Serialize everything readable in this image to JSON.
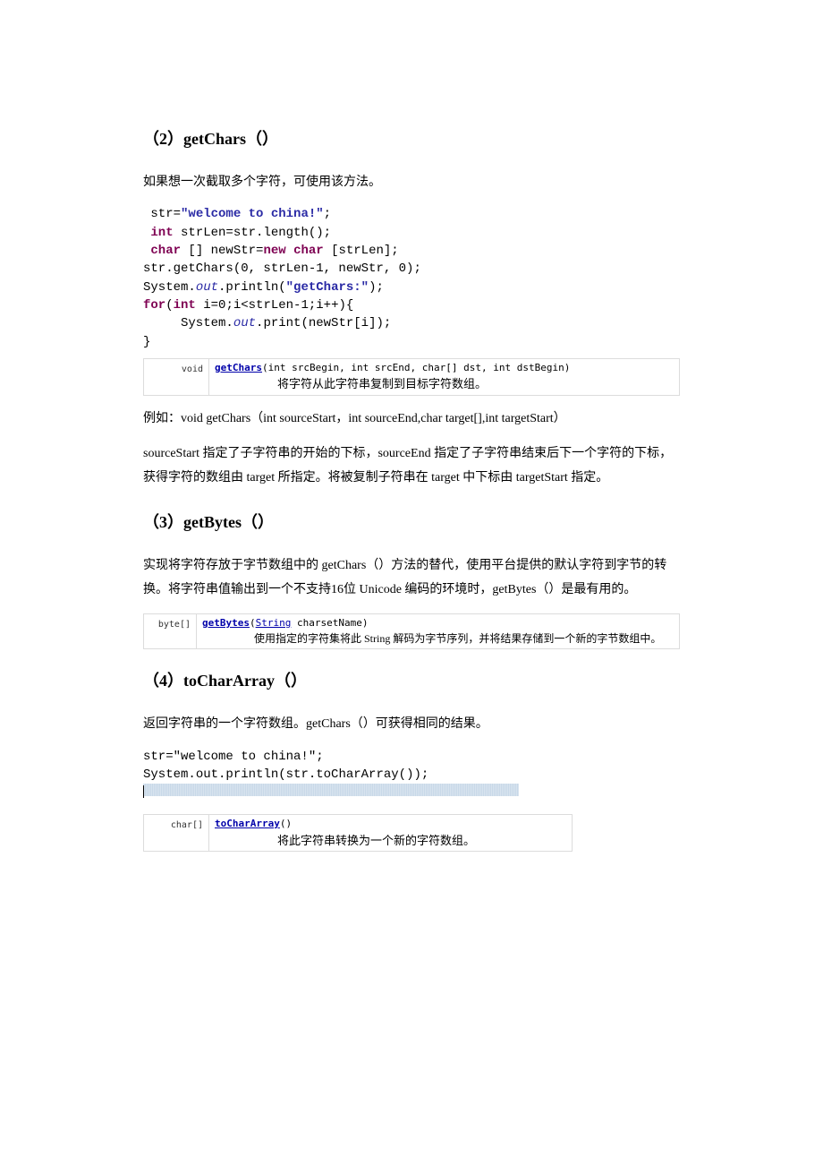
{
  "h_getChars": "（2）getChars（）",
  "p_getChars_intro": "如果想一次截取多个字符，可使用该方法。",
  "code_getChars_l1a": " str=",
  "code_getChars_l1b": "\"welcome to china!\"",
  "code_getChars_l1c": ";",
  "code_getChars_l2a": " ",
  "code_getChars_kw_int": "int",
  "code_getChars_l2b": " strLen=str.length();",
  "code_getChars_l3a": " ",
  "code_getChars_kw_char": "char",
  "code_getChars_l3b": " [] newStr=",
  "code_getChars_kw_new": "new",
  "code_getChars_l3c": " ",
  "code_getChars_kw_char2": "char",
  "code_getChars_l3d": " [strLen];",
  "code_getChars_l4": "str.getChars(0, strLen-1, newStr, 0);",
  "code_getChars_l5a": "System.",
  "code_getChars_stat_out": "out",
  "code_getChars_l5b": ".println(",
  "code_getChars_l5c": "\"getChars:\"",
  "code_getChars_l5d": ");",
  "code_getChars_l6a": "",
  "code_getChars_kw_for": "for",
  "code_getChars_l6b": "(",
  "code_getChars_kw_int2": "int",
  "code_getChars_l6c": " i=0;i<strLen-1;i++){",
  "code_getChars_l7a": "     System.",
  "code_getChars_l7b": ".print(newStr[i]);",
  "code_getChars_l8": "}",
  "doc_getChars_ret": "void",
  "doc_getChars_name": "getChars",
  "doc_getChars_params": "(int srcBegin, int srcEnd, char[] dst, int dstBegin)",
  "doc_getChars_desc": "将字符从此字符串复制到目标字符数组。",
  "p_example": "例如：void getChars（int sourceStart，int sourceEnd,char target[],int targetStart）",
  "p_source_desc": "sourceStart 指定了子字符串的开始的下标，sourceEnd 指定了子字符串结束后下一个字符的下标，获得字符的数组由 target 所指定。将被复制子符串在 target 中下标由 targetStart 指定。",
  "h_getBytes": "（3）getBytes（）",
  "p_getBytes_intro": "实现将字符存放于字节数组中的 getChars（）方法的替代，使用平台提供的默认字符到字节的转换。将字符串值输出到一个不支持16位 Unicode 编码的环境时，getBytes（）是最有用的。",
  "doc_getBytes_ret": "byte[]",
  "doc_getBytes_name": "getBytes",
  "doc_getBytes_ptype": "String",
  "doc_getBytes_pname": " charsetName)",
  "doc_getBytes_desc": "使用指定的字符集将此 String 解码为字节序列，并将结果存储到一个新的字节数组中。",
  "h_toCharArray": "（4）toCharArray（）",
  "p_toCharArray_intro": "返回字符串的一个字符数组。getChars（）可获得相同的结果。",
  "code_tca_l1a": "str=",
  "code_tca_l1b": "\"welcome to china!\"",
  "code_tca_l1c": ";",
  "code_tca_l2a": "System.",
  "code_tca_l2b": ".println(str.toCharArray());",
  "doc_tca_ret": "char[]",
  "doc_tca_name": "toCharArray",
  "doc_tca_params": "()",
  "doc_tca_desc": "将此字符串转换为一个新的字符数组。"
}
